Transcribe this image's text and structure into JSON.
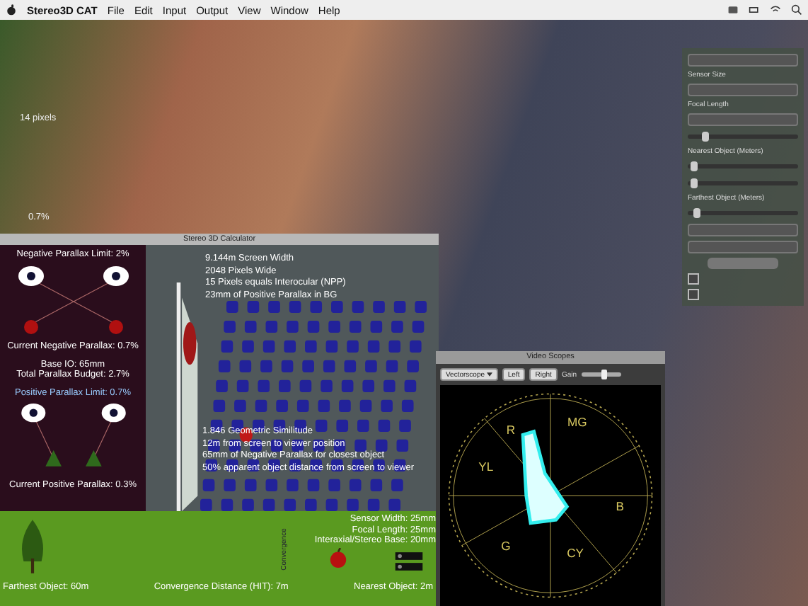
{
  "menubar": {
    "app": "Stereo3D CAT",
    "menus": [
      "File",
      "Edit",
      "Input",
      "Output",
      "View",
      "Window",
      "Help"
    ]
  },
  "video_overlay": {
    "pixel_label": "14 pixels",
    "percent_label": "0.7%"
  },
  "calculator": {
    "title": "Stereo 3D Calculator",
    "left_texts": {
      "negative_limit": "Negative Parallax Limit: 2%",
      "current_negative": "Current Negative Parallax: 0.7%",
      "base_io": "Base IO: 65mm",
      "budget": "Total Parallax Budget: 2.7%",
      "positive_limit": "Positive Parallax Limit: 0.7%",
      "current_positive": "Current Positive Parallax: 0.3%"
    },
    "screen_lines": [
      "9.144m Screen Width",
      "2048 Pixels Wide",
      "15 Pixels equals Interocular (NPP)",
      "23mm of Positive Parallax in BG"
    ],
    "viewer_lines": [
      "1.846 Geometric Similitude",
      "12m from screen to viewer position",
      "65mm of Negative Parallax for closest object",
      "50% apparent object distance from screen to viewer"
    ],
    "camera_lines": [
      "Sensor Width: 25mm",
      "Focal Length: 25mm",
      "Interaxial/Stereo Base: 20mm"
    ],
    "convergence_axis": "Convergence",
    "distances": [
      "Farthest Object: 60m",
      "Convergence Distance (HIT): 7m",
      "Nearest Object: 2m"
    ]
  },
  "scope": {
    "title": "Video Scopes",
    "mode": "Vectorscope",
    "buttons": [
      "Left",
      "Right"
    ],
    "gain_label": "Gain",
    "gain": {
      "level": 0.6
    },
    "targets": [
      {
        "label": "R"
      },
      {
        "label": "MG"
      },
      {
        "label": "B"
      },
      {
        "label": "CY"
      },
      {
        "label": "G"
      },
      {
        "label": "YL"
      }
    ]
  },
  "side_panel": {
    "controls": [
      {
        "kind": "select"
      },
      {
        "kind": "label",
        "text": "Sensor Size"
      },
      {
        "kind": "select"
      },
      {
        "kind": "label",
        "text": "Focal Length"
      },
      {
        "kind": "select"
      },
      {
        "kind": "slider",
        "level": 0.15
      },
      {
        "kind": "label",
        "text": "Nearest Object (Meters)"
      },
      {
        "kind": "slider",
        "level": 0.05
      },
      {
        "kind": "slider",
        "level": 0.05
      },
      {
        "kind": "label",
        "text": "Farthest Object (Meters)"
      },
      {
        "kind": "slider",
        "level": 0.08
      },
      {
        "kind": "select"
      },
      {
        "kind": "select"
      },
      {
        "kind": "button"
      },
      {
        "kind": "checkbox",
        "checked": false
      },
      {
        "kind": "checkbox",
        "checked": false
      }
    ]
  }
}
